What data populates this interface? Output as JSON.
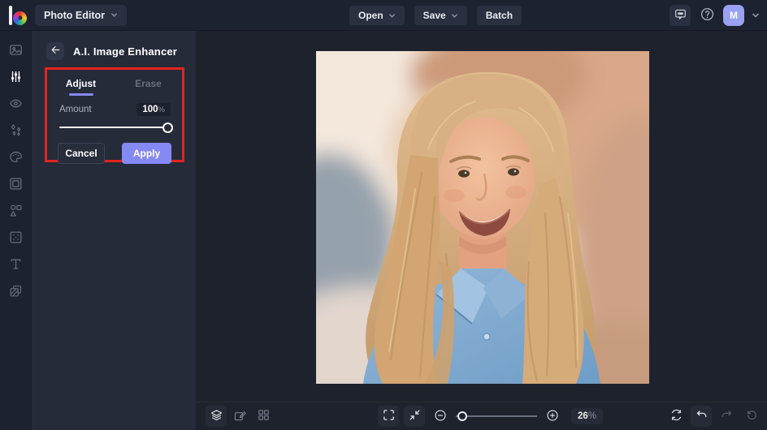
{
  "colors": {
    "topbar_bg": "#1d2230",
    "panel_bg": "#262b39",
    "canvas_bg": "#1e222c",
    "button_bg": "#2a3040",
    "accent": "#8589f3",
    "annotation_red": "#e2241c",
    "avatar_bg": "#9aa0f4"
  },
  "topbar": {
    "logo_icon": "befunky-logo",
    "app_menu_label": "Photo Editor",
    "open_label": "Open",
    "save_label": "Save",
    "batch_label": "Batch",
    "feedback_icon": "chat-bubble-icon",
    "help_icon": "question-circle-icon",
    "avatar_initial": "M"
  },
  "sidebar": {
    "items": [
      {
        "icon": "image-edit-icon",
        "active": false
      },
      {
        "icon": "adjust-sliders-icon",
        "active": true
      },
      {
        "icon": "touchup-eye-icon",
        "active": false
      },
      {
        "icon": "effects-sparkles-icon",
        "active": false
      },
      {
        "icon": "artsy-palette-icon",
        "active": false
      },
      {
        "icon": "frames-icon",
        "active": false
      },
      {
        "icon": "graphics-shapes-icon",
        "active": false
      },
      {
        "icon": "overlays-icon",
        "active": false
      },
      {
        "icon": "text-icon",
        "active": false
      },
      {
        "icon": "textures-icon",
        "active": false
      }
    ]
  },
  "panel": {
    "back_icon": "arrow-left-icon",
    "title": "A.I. Image Enhancer",
    "tabs": [
      {
        "label": "Adjust",
        "active": true
      },
      {
        "label": "Erase",
        "active": false
      }
    ],
    "amount_label": "Amount",
    "amount_value": "100",
    "amount_unit": "%",
    "amount_percent": 100,
    "cancel_label": "Cancel",
    "apply_label": "Apply"
  },
  "canvas": {
    "image_description": "portrait of smiling woman with long blonde wavy hair wearing a denim jacket, blurred warm stone background"
  },
  "statusbar": {
    "zoom_value": "26",
    "zoom_unit": "%",
    "zoom_percent": 26
  }
}
